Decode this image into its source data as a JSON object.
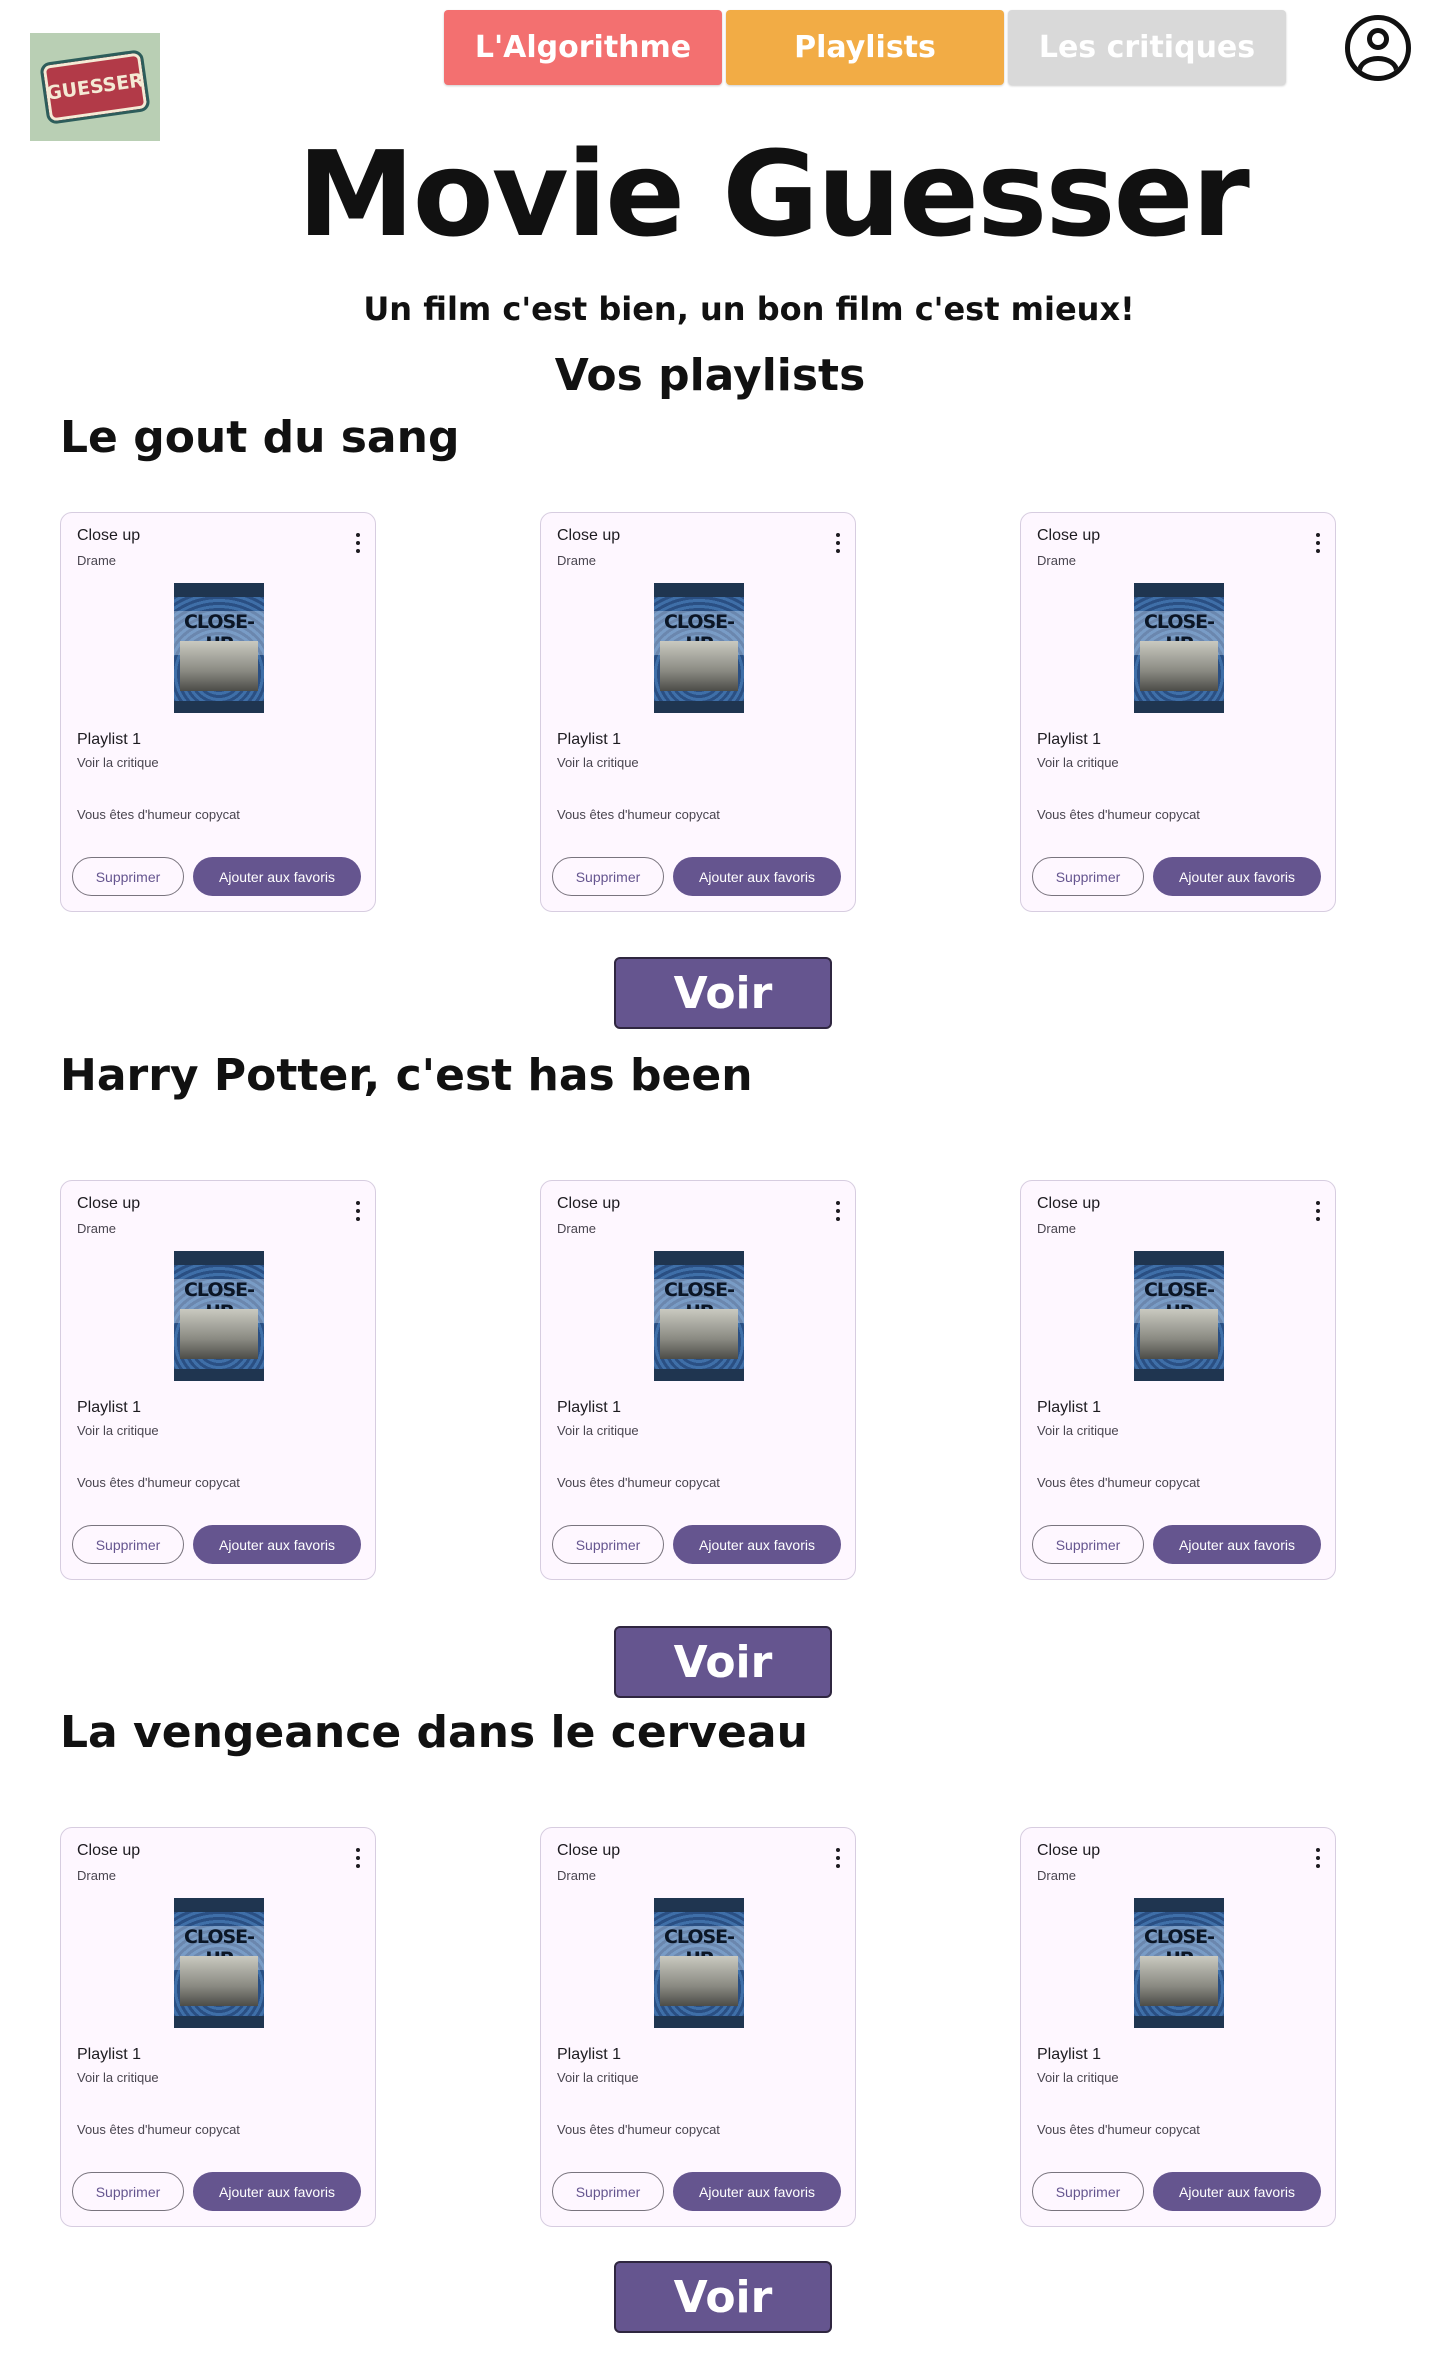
{
  "header": {
    "logo_text": "GUESSER",
    "nav": [
      {
        "label": "L'Algorithme",
        "color": "#f37070"
      },
      {
        "label": "Playlists",
        "color": "#f2ac45"
      },
      {
        "label": "Les critiques",
        "color": "#d9d9d9"
      }
    ]
  },
  "site_title": "Movie Guesser",
  "tagline": "Un film c'est bien, un bon film c'est mieux!",
  "section_title": "Vos playlists",
  "playlists": [
    {
      "title": "Le gout du sang",
      "cards": [
        {
          "title": "Close up",
          "genre": "Drame",
          "poster_text": "CLOSE-UP",
          "subtitle": "Playlist 1",
          "link": "Voir la critique",
          "desc": "Vous êtes d'humeur copycat",
          "btn_secondary": "Supprimer",
          "btn_primary": "Ajouter aux favoris"
        },
        {
          "title": "Close up",
          "genre": "Drame",
          "poster_text": "CLOSE-UP",
          "subtitle": "Playlist 1",
          "link": "Voir la critique",
          "desc": "Vous êtes d'humeur copycat",
          "btn_secondary": "Supprimer",
          "btn_primary": "Ajouter aux favoris"
        },
        {
          "title": "Close up",
          "genre": "Drame",
          "poster_text": "CLOSE-UP",
          "subtitle": "Playlist 1",
          "link": "Voir la critique",
          "desc": "Vous êtes d'humeur copycat",
          "btn_secondary": "Supprimer",
          "btn_primary": "Ajouter aux favoris"
        }
      ],
      "voir": "Voir"
    },
    {
      "title": "Harry Potter, c'est has been",
      "cards": [
        {
          "title": "Close up",
          "genre": "Drame",
          "poster_text": "CLOSE-UP",
          "subtitle": "Playlist 1",
          "link": "Voir la critique",
          "desc": "Vous êtes d'humeur copycat",
          "btn_secondary": "Supprimer",
          "btn_primary": "Ajouter aux favoris"
        },
        {
          "title": "Close up",
          "genre": "Drame",
          "poster_text": "CLOSE-UP",
          "subtitle": "Playlist 1",
          "link": "Voir la critique",
          "desc": "Vous êtes d'humeur copycat",
          "btn_secondary": "Supprimer",
          "btn_primary": "Ajouter aux favoris"
        },
        {
          "title": "Close up",
          "genre": "Drame",
          "poster_text": "CLOSE-UP",
          "subtitle": "Playlist 1",
          "link": "Voir la critique",
          "desc": "Vous êtes d'humeur copycat",
          "btn_secondary": "Supprimer",
          "btn_primary": "Ajouter aux favoris"
        }
      ],
      "voir": "Voir"
    },
    {
      "title": "La vengeance dans le cerveau",
      "cards": [
        {
          "title": "Close up",
          "genre": "Drame",
          "poster_text": "CLOSE-UP",
          "subtitle": "Playlist 1",
          "link": "Voir la critique",
          "desc": "Vous êtes d'humeur copycat",
          "btn_secondary": "Supprimer",
          "btn_primary": "Ajouter aux favoris"
        },
        {
          "title": "Close up",
          "genre": "Drame",
          "poster_text": "CLOSE-UP",
          "subtitle": "Playlist 1",
          "link": "Voir la critique",
          "desc": "Vous êtes d'humeur copycat",
          "btn_secondary": "Supprimer",
          "btn_primary": "Ajouter aux favoris"
        },
        {
          "title": "Close up",
          "genre": "Drame",
          "poster_text": "CLOSE-UP",
          "subtitle": "Playlist 1",
          "link": "Voir la critique",
          "desc": "Vous êtes d'humeur copycat",
          "btn_secondary": "Supprimer",
          "btn_primary": "Ajouter aux favoris"
        }
      ],
      "voir": "Voir"
    }
  ]
}
